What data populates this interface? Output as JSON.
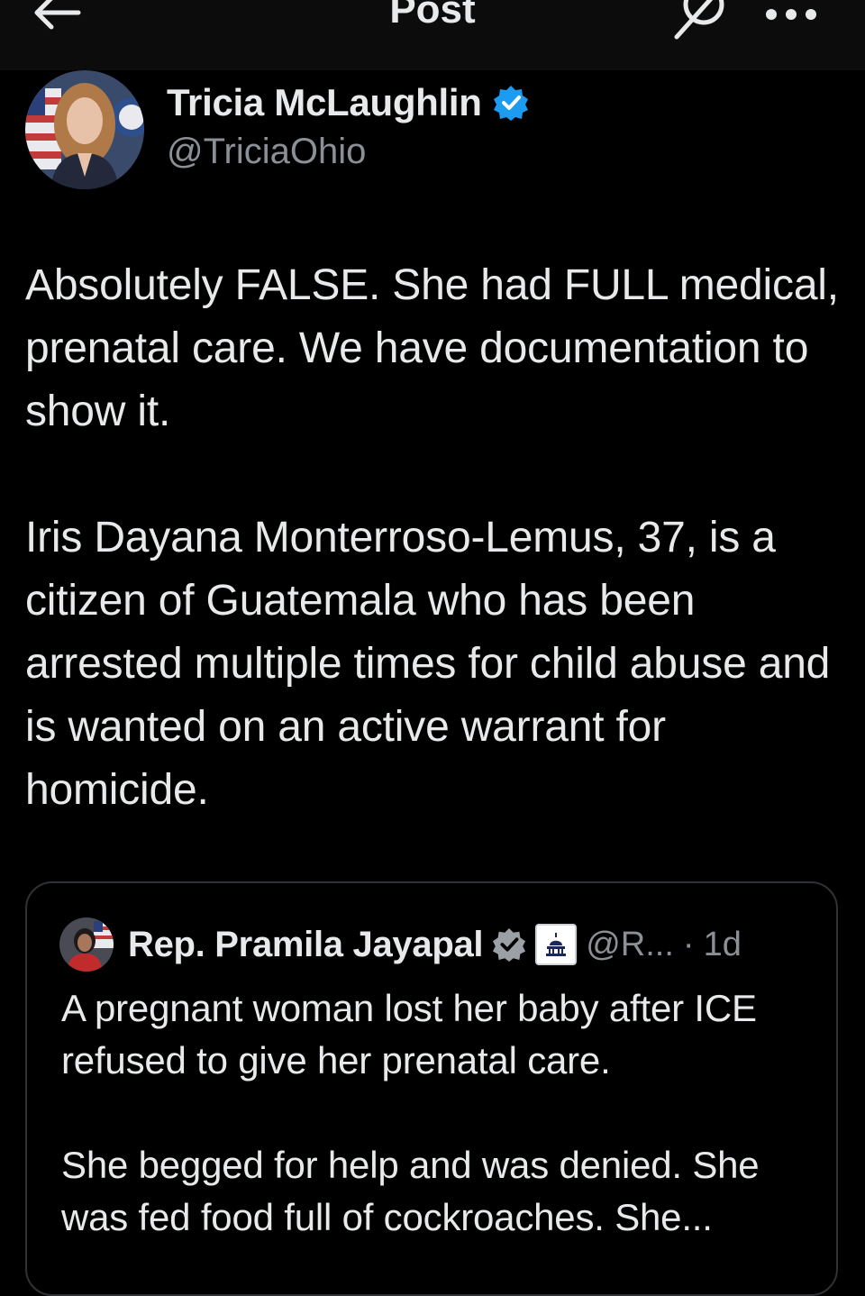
{
  "header": {
    "title": "Post",
    "icons": {
      "back": "arrow-left-icon",
      "grok": "grok-icon",
      "more": "more-icon"
    }
  },
  "post": {
    "author_name": "Tricia McLaughlin",
    "author_handle": "@TriciaOhio",
    "verified": true,
    "text": "Absolutely FALSE. She had FULL medical, prenatal care. We have documentation to show it.\n\nIris Dayana Monterroso-Lemus, 37, is a citizen of Guatemala who has been arrested multiple times for child abuse and is wanted on an active warrant for homicide."
  },
  "quoted_post": {
    "author_name": "Rep. Pramila Jayapal",
    "verified": true,
    "handle": "@R...",
    "separator": "·",
    "time": "1d",
    "text": "A pregnant woman lost her baby after ICE refused to give her prenatal care.\n\nShe begged for help and was denied. She was fed food full of cockroaches. She..."
  },
  "colors": {
    "background": "#000000",
    "text_primary": "#e7e9ea",
    "text_secondary": "#8b9096",
    "verified_badge": "#1d9bf0",
    "border": "#2f3336"
  }
}
